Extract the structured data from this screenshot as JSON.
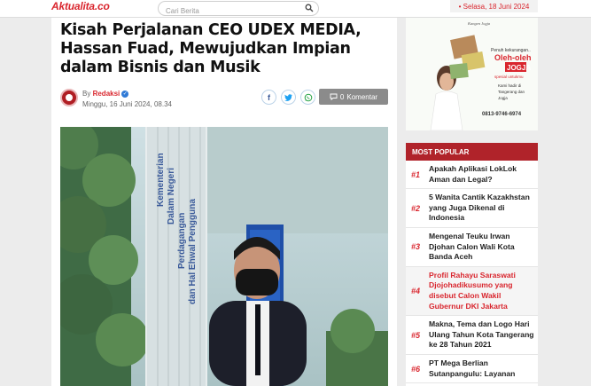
{
  "header": {
    "logo_main": "Aktualita",
    "logo_ext": ".co",
    "search_placeholder": "Cari Berita",
    "date": "• Selasa, 18 Juni 2024"
  },
  "article": {
    "title": "Kisah Perjalanan CEO UDEX MEDIA, Hassan Fuad, Mewujudkan Impian dalam Bisnis dan Musik",
    "by_prefix": "By",
    "author": "Redaksi",
    "published": "Minggu, 16 Juni 2024, 08.34",
    "share_facebook": "f",
    "share_twitter": "t",
    "share_whatsapp": "w",
    "comment_count": "0",
    "comment_label": "Komentar",
    "photo_sign_lines": [
      "Kementerian",
      "Dalam Negeri",
      "Perdagangan",
      "dan Hal Ehwal Pengguna"
    ]
  },
  "ad": {
    "top": "Kangen Jogja",
    "line1": "Penuh kekurangan..",
    "line2": "Oleh-oleh",
    "line3": "JOGJA",
    "line4": "spesial untukmu",
    "line5": "Kami hadir di",
    "line6": "Tangerang dan",
    "line7": "Jogja",
    "phone": "0813-9746-6974"
  },
  "popular": {
    "heading": "MOST POPULAR",
    "items": [
      {
        "num": "#1",
        "title": "Apakah Aplikasi LokLok Aman dan Legal?"
      },
      {
        "num": "#2",
        "title": "5 Wanita Cantik Kazakhstan yang Juga Dikenal di Indonesia"
      },
      {
        "num": "#3",
        "title": "Mengenal Teuku Irwan Djohan Calon Wali Kota Banda Aceh"
      },
      {
        "num": "#4",
        "title": "Profil Rahayu Saraswati Djojohadikusumo yang disebut Calon Wakil Gubernur DKI Jakarta"
      },
      {
        "num": "#5",
        "title": "Makna, Tema dan Logo Hari Ulang Tahun Kota Tangerang ke 28 Tahun 2021"
      },
      {
        "num": "#6",
        "title": "PT Mega Berlian Sutanpangulu: Layanan"
      }
    ]
  },
  "colors": {
    "brand_red": "#d9262e",
    "popular_header": "#b0232a",
    "comment_button": "#8b8b8b"
  }
}
